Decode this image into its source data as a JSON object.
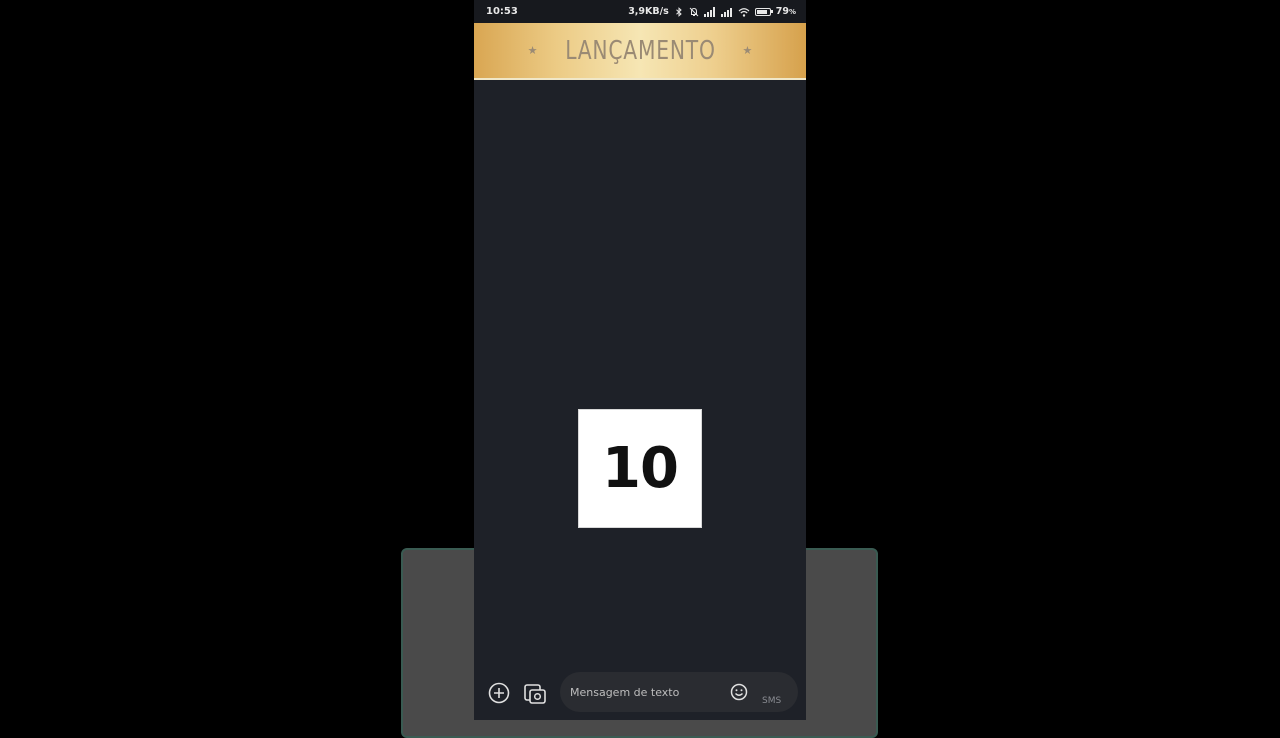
{
  "status_bar": {
    "time": "10:53",
    "speed": "3,9KB/s",
    "battery_percent": "79",
    "battery_suffix": "%",
    "icons": [
      "bluetooth-icon",
      "mute-bell-icon",
      "signal-icon",
      "signal-4g-icon",
      "wifi-icon",
      "battery-icon"
    ]
  },
  "banner": {
    "title": "LANÇAMENTO",
    "star": "★",
    "colors": {
      "gold_light": "#f6e6b4",
      "gold_dark": "#d6a14c",
      "text": "#9a8a74"
    }
  },
  "countdown": {
    "value": "10"
  },
  "composer": {
    "placeholder": "Mensagem de texto",
    "value": "",
    "channel_label": "SMS",
    "icons": [
      "add-circle-icon",
      "gallery-icon",
      "emoji-icon"
    ]
  },
  "colors": {
    "background": "#000000",
    "screen": "#1e2128",
    "status_bar": "#17191e",
    "input_bg": "#2a2c31"
  }
}
